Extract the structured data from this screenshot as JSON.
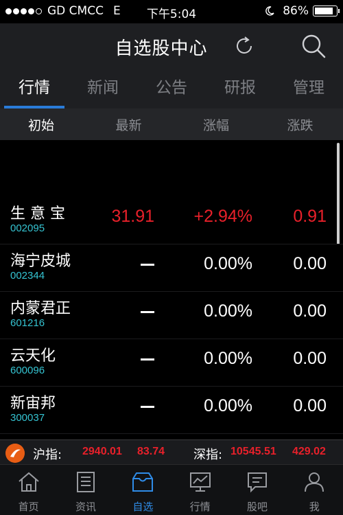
{
  "status": {
    "carrier": "GD CMCC",
    "network": "E",
    "time": "下午5:04",
    "battery": "86%",
    "battery_level": 0.86
  },
  "nav": {
    "title": "自选股中心",
    "icons": [
      "refresh-icon",
      "search-icon"
    ]
  },
  "tabs": [
    {
      "label": "行情",
      "active": true
    },
    {
      "label": "新闻",
      "active": false
    },
    {
      "label": "公告",
      "active": false
    },
    {
      "label": "研报",
      "active": false
    },
    {
      "label": "管理",
      "active": false
    }
  ],
  "columns": [
    "初始",
    "最新",
    "涨幅",
    "涨跌"
  ],
  "stocks": [
    {
      "name": "生 意 宝",
      "code": "002095",
      "price": "31.91",
      "pct": "+2.94%",
      "chg": "0.91"
    },
    {
      "name": "海宁皮城",
      "code": "002344",
      "price": "",
      "pct": "0.00%",
      "chg": "0.00"
    },
    {
      "name": "内蒙君正",
      "code": "601216",
      "price": "",
      "pct": "0.00%",
      "chg": "0.00"
    },
    {
      "name": "云天化",
      "code": "600096",
      "price": "",
      "pct": "0.00%",
      "chg": "0.00"
    },
    {
      "name": "新宙邦",
      "code": "300037",
      "price": "",
      "pct": "0.00%",
      "chg": "0.00"
    }
  ],
  "indices": {
    "sh_label": "沪指:",
    "sh_value": "2940.01",
    "sh_change": "83.74",
    "sz_label": "深指:",
    "sz_value": "10545.51",
    "sz_change": "429.02"
  },
  "bottom_tabs": [
    {
      "label": "首页",
      "icon": "home-icon"
    },
    {
      "label": "资讯",
      "icon": "news-icon"
    },
    {
      "label": "自选",
      "icon": "watchlist-icon",
      "active": true
    },
    {
      "label": "行情",
      "icon": "chart-icon"
    },
    {
      "label": "股吧",
      "icon": "forum-icon"
    },
    {
      "label": "我",
      "icon": "user-icon"
    }
  ],
  "colors": {
    "up": "#e8202a",
    "accent": "#2a7bd8",
    "code": "#35c4d2"
  }
}
